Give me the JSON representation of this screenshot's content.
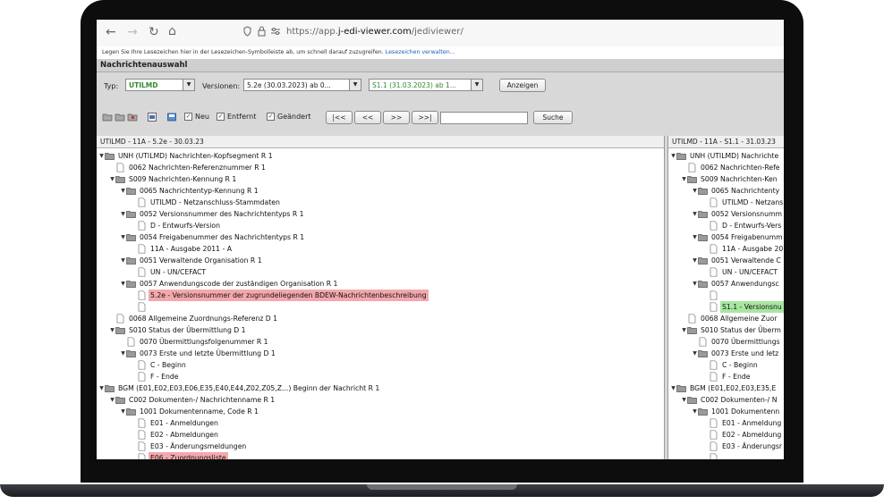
{
  "browser": {
    "url_prefix": "https://app.",
    "url_host": "j-edi-viewer.com",
    "url_path": "/jediviewer/",
    "bookmarks_hint": "Legen Sie Ihre Lesezeichen hier in der Lesezeichen-Symbolleiste ab, um schnell darauf zuzugreifen.",
    "bookmarks_link": "Lesezeichen verwalten..."
  },
  "app": {
    "header_title": "Nachrichtenauswahl",
    "type_label": "Typ:",
    "type_value": "UTILMD",
    "versions_label": "Versionen:",
    "version_a": "5.2e (30.03.2023) ab 0...",
    "version_b": "S1.1 (31.03.2023) ab 1...",
    "show_button": "Anzeigen",
    "chk_new": "Neu",
    "chk_removed": "Entfernt",
    "chk_changed": "Geändert",
    "nav_first": "|<<",
    "nav_prev": "<<",
    "nav_next": ">>",
    "nav_last": ">>|",
    "search_value": "",
    "search_button": "Suche",
    "colors": {
      "removed": "#f4a8ac",
      "added": "#a8e6a0",
      "type_text": "#2e8b2e"
    }
  },
  "left_pane": {
    "title": "UTILMD - 11A - 5.2e - 30.03.23",
    "nodes": [
      {
        "text": "UNH (UTILMD) Nachrichten-Kopfsegment R 1",
        "type": "folder"
      },
      {
        "text": "0062 Nachrichten-Referenznummer R 1",
        "type": "leaf"
      },
      {
        "text": "S009 Nachrichten-Kennung R 1",
        "type": "folder"
      },
      {
        "text": "0065 Nachrichtentyp-Kennung R 1",
        "type": "folder"
      },
      {
        "text": "UTILMD - Netzanschluss-Stammdaten",
        "type": "leaf"
      },
      {
        "text": "0052 Versionsnummer des Nachrichtentyps R 1",
        "type": "folder"
      },
      {
        "text": "D - Entwurfs-Version",
        "type": "leaf"
      },
      {
        "text": "0054 Freigabenummer des Nachrichtentyps R 1",
        "type": "folder"
      },
      {
        "text": "11A - Ausgabe 2011 - A",
        "type": "leaf"
      },
      {
        "text": "0051 Verwaltende Organisation R 1",
        "type": "folder"
      },
      {
        "text": "UN - UN/CEFACT",
        "type": "leaf"
      },
      {
        "text": "0057 Anwendungscode der zuständigen Organisation R 1",
        "type": "folder"
      },
      {
        "text": "5.2e - Versionsnummer der zugrundeliegenden BDEW-Nachrichtenbeschreibung",
        "type": "leaf",
        "hl": "red"
      },
      {
        "text": "",
        "type": "leaf"
      },
      {
        "text": "0068 Allgemeine Zuordnungs-Referenz D 1",
        "type": "leaf"
      },
      {
        "text": "S010 Status der Übermittlung D 1",
        "type": "folder"
      },
      {
        "text": "0070 Übermittlungsfolgenummer R 1",
        "type": "leaf"
      },
      {
        "text": "0073 Erste und letzte Übermittlung D 1",
        "type": "folder"
      },
      {
        "text": "C - Beginn",
        "type": "leaf"
      },
      {
        "text": "F - Ende",
        "type": "leaf"
      },
      {
        "text": "BGM (E01,E02,E03,E06,E35,E40,E44,Z02,Z05,Z...) Beginn der Nachricht R 1",
        "type": "folder"
      },
      {
        "text": "C002 Dokumenten-/ Nachrichtenname R 1",
        "type": "folder"
      },
      {
        "text": "1001 Dokumentenname, Code R 1",
        "type": "folder"
      },
      {
        "text": "E01 - Anmeldungen",
        "type": "leaf"
      },
      {
        "text": "E02 - Abmeldungen",
        "type": "leaf"
      },
      {
        "text": "E03 - Änderungsmeldungen",
        "type": "leaf"
      },
      {
        "text": "E06 - Zuordnungsliste",
        "type": "leaf",
        "hl": "red"
      }
    ]
  },
  "right_pane": {
    "title": "UTILMD - 11A - S1.1 - 31.03.23",
    "nodes": [
      {
        "text": "UNH (UTILMD) Nachrichte",
        "type": "folder"
      },
      {
        "text": "0062 Nachrichten-Refe",
        "type": "leaf"
      },
      {
        "text": "S009 Nachrichten-Ken",
        "type": "folder"
      },
      {
        "text": "0065 Nachrichtenty",
        "type": "folder"
      },
      {
        "text": "UTILMD - Netzans",
        "type": "leaf"
      },
      {
        "text": "0052 Versionsnumm",
        "type": "folder"
      },
      {
        "text": "D - Entwurfs-Vers",
        "type": "leaf"
      },
      {
        "text": "0054 Freigabenumm",
        "type": "folder"
      },
      {
        "text": "11A - Ausgabe 20",
        "type": "leaf"
      },
      {
        "text": "0051 Verwaltende C",
        "type": "folder"
      },
      {
        "text": "UN - UN/CEFACT",
        "type": "leaf"
      },
      {
        "text": "0057 Anwendungsc",
        "type": "folder"
      },
      {
        "text": "",
        "type": "leaf"
      },
      {
        "text": "S1.1 - Versionsnu",
        "type": "leaf",
        "hl": "green"
      },
      {
        "text": "0068 Allgemeine Zuor",
        "type": "leaf"
      },
      {
        "text": "S010 Status der Überm",
        "type": "folder"
      },
      {
        "text": "0070 Übermittlungs",
        "type": "leaf"
      },
      {
        "text": "0073 Erste und letz",
        "type": "folder"
      },
      {
        "text": "C - Beginn",
        "type": "leaf"
      },
      {
        "text": "F - Ende",
        "type": "leaf"
      },
      {
        "text": "BGM (E01,E02,E03,E35,E",
        "type": "folder"
      },
      {
        "text": "C002 Dokumenten-/ N",
        "type": "folder"
      },
      {
        "text": "1001 Dokumentenn",
        "type": "folder"
      },
      {
        "text": "E01 - Anmeldung",
        "type": "leaf"
      },
      {
        "text": "E02 - Abmeldung",
        "type": "leaf"
      },
      {
        "text": "E03 - Änderungsr",
        "type": "leaf"
      },
      {
        "text": "",
        "type": "leaf"
      }
    ]
  }
}
